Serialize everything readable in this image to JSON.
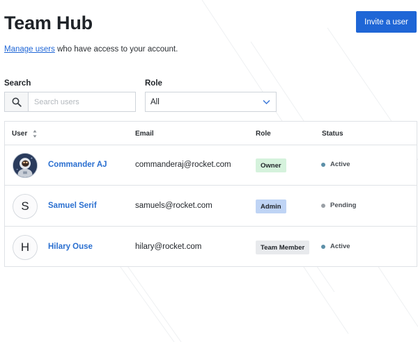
{
  "page": {
    "title": "Team Hub",
    "invite_label": "Invite a user",
    "subtitle_link": "Manage users",
    "subtitle_rest": " who have access to your account."
  },
  "filters": {
    "search_label": "Search",
    "search_placeholder": "Search users",
    "role_label": "Role",
    "role_value": "All"
  },
  "table": {
    "headers": [
      "User",
      "Email",
      "Role",
      "Status"
    ],
    "rows": [
      {
        "initial": "",
        "avatar": "astronaut-photo",
        "name": "Commander AJ",
        "email": "commanderaj@rocket.com",
        "role": "Owner",
        "status": "Active"
      },
      {
        "initial": "S",
        "avatar": "initial",
        "name": "Samuel Serif",
        "email": "samuels@rocket.com",
        "role": "Admin",
        "status": "Pending"
      },
      {
        "initial": "H",
        "avatar": "initial",
        "name": "Hilary Ouse",
        "email": "hilary@rocket.com",
        "role": "Team Member",
        "status": "Active"
      }
    ]
  },
  "colors": {
    "accent": "#1f66d6",
    "owner_badge": "#d5f2dc",
    "admin_badge": "#bfd4f5",
    "member_badge": "#e8eaed",
    "active_dot": "#5c8fa8",
    "pending_dot": "#9aa0a6"
  }
}
